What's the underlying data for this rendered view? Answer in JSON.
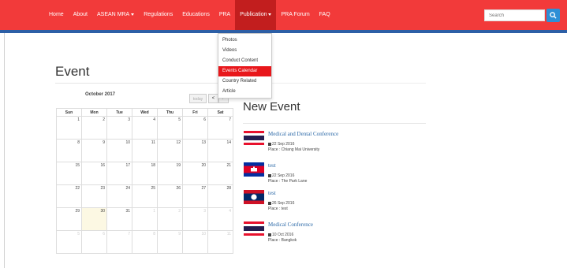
{
  "nav": {
    "items": [
      {
        "label": "Home",
        "active": false,
        "dropdown": false
      },
      {
        "label": "About",
        "active": false,
        "dropdown": false
      },
      {
        "label": "ASEAN MRA",
        "active": false,
        "dropdown": true
      },
      {
        "label": "Regulations",
        "active": false,
        "dropdown": false
      },
      {
        "label": "Educations",
        "active": false,
        "dropdown": false
      },
      {
        "label": "PRA",
        "active": false,
        "dropdown": false
      },
      {
        "label": "Publication",
        "active": true,
        "dropdown": true
      },
      {
        "label": "PRA Forum",
        "active": false,
        "dropdown": false
      },
      {
        "label": "FAQ",
        "active": false,
        "dropdown": false
      }
    ],
    "search_placeholder": "Search",
    "colors": {
      "bar": "#f23a3a",
      "border": "#2d5fa6",
      "active": "#c21e1e",
      "search_button": "#2d8fd6"
    }
  },
  "dropdown": {
    "items": [
      {
        "label": "Photos",
        "active": false
      },
      {
        "label": "Videos",
        "active": false
      },
      {
        "label": "Conduct Content",
        "active": false
      },
      {
        "label": "Events Calendar",
        "active": true
      },
      {
        "label": "Country Related",
        "active": false
      },
      {
        "label": "Article",
        "active": false
      }
    ]
  },
  "page": {
    "title": "Event"
  },
  "calendar": {
    "month_label": "October 2017",
    "today_label": "today",
    "prev_label": "<",
    "next_label": ">",
    "weekdays": [
      "Sun",
      "Mon",
      "Tue",
      "Wed",
      "Thu",
      "Fri",
      "Sat"
    ],
    "weeks": [
      [
        {
          "d": "1",
          "o": false,
          "t": false
        },
        {
          "d": "2",
          "o": false,
          "t": false
        },
        {
          "d": "3",
          "o": false,
          "t": false
        },
        {
          "d": "4",
          "o": false,
          "t": false
        },
        {
          "d": "5",
          "o": false,
          "t": false
        },
        {
          "d": "6",
          "o": false,
          "t": false
        },
        {
          "d": "7",
          "o": false,
          "t": false
        }
      ],
      [
        {
          "d": "8",
          "o": false,
          "t": false
        },
        {
          "d": "9",
          "o": false,
          "t": false
        },
        {
          "d": "10",
          "o": false,
          "t": false
        },
        {
          "d": "11",
          "o": false,
          "t": false
        },
        {
          "d": "12",
          "o": false,
          "t": false
        },
        {
          "d": "13",
          "o": false,
          "t": false
        },
        {
          "d": "14",
          "o": false,
          "t": false
        }
      ],
      [
        {
          "d": "15",
          "o": false,
          "t": false
        },
        {
          "d": "16",
          "o": false,
          "t": false
        },
        {
          "d": "17",
          "o": false,
          "t": false
        },
        {
          "d": "18",
          "o": false,
          "t": false
        },
        {
          "d": "19",
          "o": false,
          "t": false
        },
        {
          "d": "20",
          "o": false,
          "t": false
        },
        {
          "d": "21",
          "o": false,
          "t": false
        }
      ],
      [
        {
          "d": "22",
          "o": false,
          "t": false
        },
        {
          "d": "23",
          "o": false,
          "t": false
        },
        {
          "d": "24",
          "o": false,
          "t": false
        },
        {
          "d": "25",
          "o": false,
          "t": false
        },
        {
          "d": "26",
          "o": false,
          "t": false
        },
        {
          "d": "27",
          "o": false,
          "t": false
        },
        {
          "d": "28",
          "o": false,
          "t": false
        }
      ],
      [
        {
          "d": "29",
          "o": false,
          "t": false
        },
        {
          "d": "30",
          "o": false,
          "t": true
        },
        {
          "d": "31",
          "o": false,
          "t": false
        },
        {
          "d": "1",
          "o": true,
          "t": false
        },
        {
          "d": "2",
          "o": true,
          "t": false
        },
        {
          "d": "3",
          "o": true,
          "t": false
        },
        {
          "d": "4",
          "o": true,
          "t": false
        }
      ],
      [
        {
          "d": "5",
          "o": true,
          "t": false
        },
        {
          "d": "6",
          "o": true,
          "t": false
        },
        {
          "d": "7",
          "o": true,
          "t": false
        },
        {
          "d": "8",
          "o": true,
          "t": false
        },
        {
          "d": "9",
          "o": true,
          "t": false
        },
        {
          "d": "10",
          "o": true,
          "t": false
        },
        {
          "d": "11",
          "o": true,
          "t": false
        }
      ]
    ]
  },
  "events": {
    "heading": "New Event",
    "items": [
      {
        "title": "Medical and Dental Conference",
        "date": "22 Sep 2016",
        "place": "Place : Chiang Mai University",
        "flag": "thailand-flag-icon"
      },
      {
        "title": "test",
        "date": "22 Sep 2016",
        "place": "Place : The Park Lane",
        "flag": "cambodia-flag-icon"
      },
      {
        "title": "test",
        "date": "26 Sep 2016",
        "place": "Place : test",
        "flag": "laos-flag-icon"
      },
      {
        "title": "Medical Conference",
        "date": "10 Oct 2016",
        "place": "Place : Bangkok",
        "flag": "thailand-flag-icon"
      }
    ]
  }
}
